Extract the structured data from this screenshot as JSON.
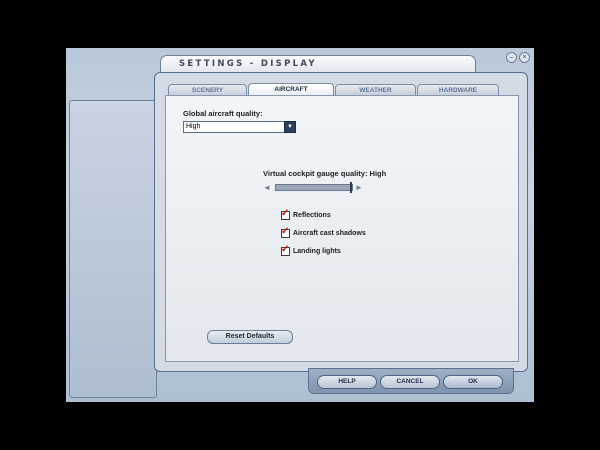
{
  "window": {
    "title": "SETTINGS - DISPLAY",
    "minimize_glyph": "–",
    "close_glyph": "×"
  },
  "tabs": [
    {
      "label": "SCENERY",
      "active": false
    },
    {
      "label": "AIRCRAFT",
      "active": true
    },
    {
      "label": "WEATHER",
      "active": false
    },
    {
      "label": "HARDWARE",
      "active": false
    }
  ],
  "aircraft": {
    "global_quality_label": "Global aircraft quality:",
    "global_quality_value": "High",
    "gauge_quality_label": "Virtual cockpit gauge quality: High",
    "gauge_quality_level": 1.0,
    "checkboxes": [
      {
        "label": "Reflections",
        "checked": true
      },
      {
        "label": "Aircraft cast shadows",
        "checked": true
      },
      {
        "label": "Landing lights",
        "checked": true
      }
    ],
    "reset_label": "Reset Defaults"
  },
  "footer": {
    "help_label": "HELP",
    "cancel_label": "CANCEL",
    "ok_label": "OK"
  },
  "colors": {
    "accent": "#2c3f5c",
    "check": "#c8141a"
  }
}
